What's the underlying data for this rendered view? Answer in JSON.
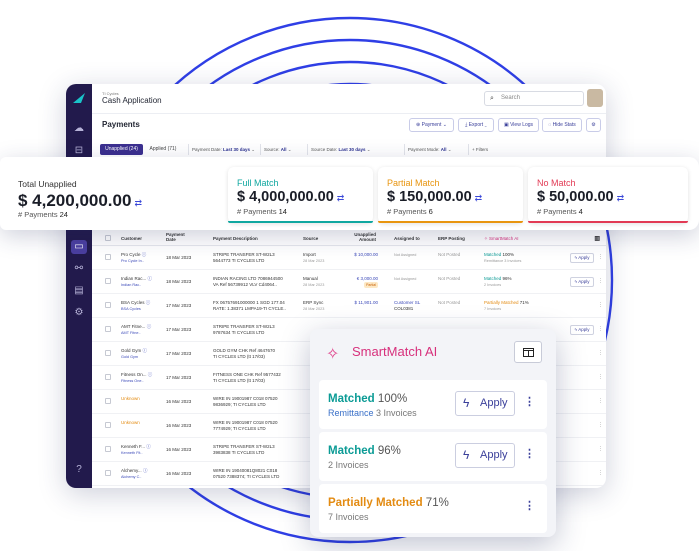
{
  "app": {
    "org_name": "TI Cycles",
    "title": "Cash Application",
    "search_placeholder": "Search",
    "page_title": "Payments"
  },
  "toolbar": {
    "payment_label": "Payment",
    "export_label": "Export",
    "view_logs_label": "View Logs",
    "hide_stats_label": "Hide Stats"
  },
  "filters": {
    "tab_unapplied": "Unapplied (24)",
    "tab_applied": "Applied (71)",
    "payment_date_label": "Payment Date:",
    "payment_date_value": "Last 30 days",
    "source_label": "Source:",
    "source_value": "All",
    "source_date_label": "Source Date:",
    "source_date_value": "Last 30 days",
    "payment_mode_label": "Payment Mode:",
    "payment_mode_value": "All",
    "more_filters": "+ Filters"
  },
  "stats": [
    {
      "label": "Total Unapplied",
      "amount": "$ 4,200,000.00",
      "payments_label": "# Payments",
      "payments": "24",
      "color": "#333333"
    },
    {
      "label": "Full Match",
      "amount": "$ 4,000,000.00",
      "payments_label": "# Payments",
      "payments": "14",
      "color": "#10a7a0"
    },
    {
      "label": "Partial Match",
      "amount": "$ 150,000.00",
      "payments_label": "# Payments",
      "payments": "6",
      "color": "#e8950f"
    },
    {
      "label": "No Match",
      "amount": "$ 50,000.00",
      "payments_label": "# Payments",
      "payments": "4",
      "color": "#e23a54"
    }
  ],
  "table": {
    "headers": {
      "customer": "Customer",
      "payment_date": "Payment Date",
      "description": "Payment Description",
      "source": "Source",
      "unapplied_amount": "Unapplied Amount",
      "assigned_to": "Assigned to",
      "erp_posting": "ERP Posting",
      "smartmatch": "SmartMatch AI"
    },
    "rows": [
      {
        "customer": "Pro Cycle",
        "customer_sub": "Pro Cycle In..",
        "date": "18 Mar 2023",
        "desc1": "STRIPE TRANSFER ST-W2L3",
        "desc2": "5644773 TI CYCLES LTD",
        "source": "Import",
        "source_sub": "28 Mar 2023",
        "amount": "$ 10,000.00",
        "assigned": "Not Assigned",
        "erp": "Not Posted",
        "match1": "Matched",
        "match_pct": "100%",
        "match2": "Remittance 3 Invoices",
        "apply": "Apply"
      },
      {
        "customer": "Indian Rac...",
        "customer_sub": "Indian Rac..",
        "date": "18 Mar 2023",
        "desc1": "INDIAN RACING LTD 7086944500",
        "desc2": "VA Ref 56739912 VLV Cd4064..",
        "source": "Manual",
        "source_sub": "28 Mar 2023",
        "amount": "€ 3,000.00",
        "amount_tag": "Partial",
        "assigned": "Not Assigned",
        "erp": "Not Posted",
        "match1": "Matched",
        "match_pct": "96%",
        "match2": "2 Invoices",
        "apply": "Apply"
      },
      {
        "customer": "BSA Cycles",
        "customer_sub": "BSA Cycles",
        "date": "17 Mar 2023",
        "desc1": "FX 06757691000000 1 SGD 177.04",
        "desc2": "RATE: 1.38371 LMPA19-TI CYCLE..",
        "source": "ERP Sync",
        "source_sub": "28 Mar 2023",
        "amount": "$ 11,901.00",
        "assigned": "Customer SL",
        "assigned_sub": "COL0381",
        "erp": "Not Posted",
        "match1": "Partially Matched",
        "match_pct": "71%",
        "match2": "7 Invoices"
      },
      {
        "customer": "AMT Fitne...",
        "customer_sub": "AMT Fitne..",
        "date": "17 Mar 2023",
        "desc1": "STRIPE TRANSFER ST-W2L3",
        "desc2": "9787634 TI CYCLES LTD",
        "apply": "Apply"
      },
      {
        "customer": "Gold Gym",
        "customer_sub": "Gold Gym",
        "date": "17 Mar 2023",
        "desc1": "GOLD GYM CHK Ref 4647670",
        "desc2": "TI CYCLES LTD (tt 17/03)"
      },
      {
        "customer": "Fitness On...",
        "customer_sub": "Fitness One..",
        "date": "17 Mar 2023",
        "desc1": "FITNESS ONE CHK Ref 9577432",
        "desc2": "TI CYCLES LTD (tt 17/03)"
      },
      {
        "customer": "Unknown",
        "date": "16 Mar 2023",
        "desc1": "WIRE IN 19001987 C018 07520",
        "desc2": "9836929; TI CYCLES LTD"
      },
      {
        "customer": "Unknown",
        "date": "16 Mar 2023",
        "desc1": "WIRE IN 19001987 C018 07520",
        "desc2": "7774929; TI CYCLES LTD"
      },
      {
        "customer": "Kenneth F...",
        "customer_sub": "Kenneth Fit..",
        "date": "16 Mar 2023",
        "desc1": "STRIPE TRANSFER ST-W2L3",
        "desc2": "3983838 TI CYCLES LTD"
      },
      {
        "customer": "Alchemy...",
        "customer_sub": "Alchemy C..",
        "date": "16 Mar 2023",
        "desc1": "WIRE IN 19040081Q8021 C018",
        "desc2": "07520 7388374; TI CYCLES LTD"
      }
    ]
  },
  "smartmatch_popup": {
    "title": "SmartMatch AI",
    "cards": [
      {
        "status": "Matched",
        "pct": "100%",
        "sub_highlight": "Remittance",
        "sub": "3 Invoices",
        "apply": "Apply",
        "color": "#0b9b95"
      },
      {
        "status": "Matched",
        "pct": "96%",
        "sub_highlight": "",
        "sub": "2 Invoices",
        "apply": "Apply",
        "color": "#0b9b95"
      },
      {
        "status": "Partially Matched",
        "pct": "71%",
        "sub_highlight": "",
        "sub": "7 Invoices",
        "color": "#e38b12"
      }
    ]
  },
  "colors": {
    "sidebar": "#221a4c",
    "accent": "#3b2f8f",
    "rings": "#2f3fe6",
    "smartmatch": "#d7307c"
  },
  "icons": {
    "search": "search-icon",
    "apply": "lightning-icon",
    "panel": "panel-icon",
    "smartmatch": "sparkle-icon"
  }
}
